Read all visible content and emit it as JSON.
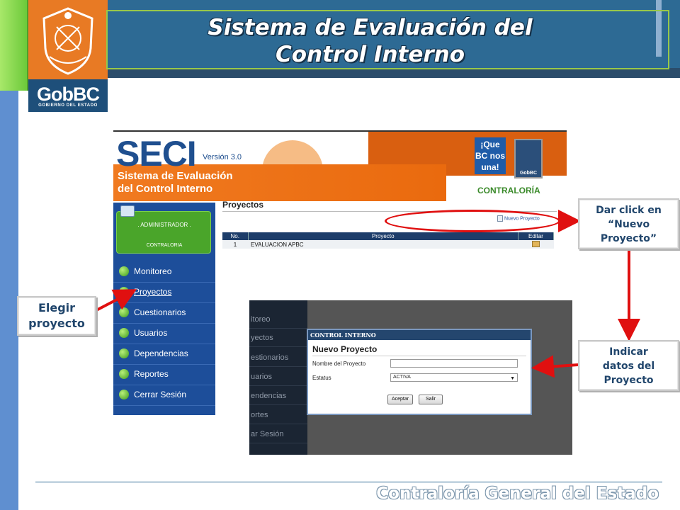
{
  "slide": {
    "title_line1": "Sistema de Evaluación del",
    "title_line2": "Control Interno",
    "footer": "Contraloría General del Estado",
    "logo_text": "GobBC",
    "logo_subtext": "GOBIERNO DEL ESTADO"
  },
  "app": {
    "brand_name": "SECI",
    "brand_version": "Versión 3.0",
    "brand_line1": "Sistema de Evaluación",
    "brand_line2": "del Control Interno",
    "badge_text": "¡Que BC nos una!",
    "badge2_text": "GobBC",
    "contraloria": "CONTRALORÍA",
    "user": {
      "role": ". ADMINISTRADOR .",
      "department": "CONTRALORIA"
    },
    "nav": [
      {
        "label": "Monitoreo"
      },
      {
        "label": "Proyectos"
      },
      {
        "label": "Cuestionarios"
      },
      {
        "label": "Usuarios"
      },
      {
        "label": "Dependencias"
      },
      {
        "label": "Reportes"
      },
      {
        "label": "Cerrar Sesión"
      }
    ],
    "projects": {
      "title": "Proyectos",
      "new_button": "Nuevo Proyecto",
      "columns": [
        "No.",
        "Proyecto",
        "Editar"
      ],
      "rows": [
        {
          "no": "1",
          "proyecto": "EVALUACION APBC"
        }
      ]
    }
  },
  "dialog": {
    "bg_nav": [
      "itoreo",
      "yectos",
      "estionarios",
      "uarios",
      "endencias",
      "ortes",
      "ar Sesión"
    ],
    "header": "CONTROL INTERNO",
    "title": "Nuevo Proyecto",
    "field_name_label": "Nombre del Proyecto",
    "field_name_value": "",
    "field_status_label": "Estatus",
    "field_status_value": "ACTIVA",
    "accept_label": "Aceptar",
    "exit_label": "Salir"
  },
  "callouts": {
    "click_new": "Dar click en “Nuevo Proyecto”",
    "choose_project": "Elegir proyecto",
    "enter_data": "Indicar datos del Proyecto"
  },
  "colors": {
    "arrow": "#e01010",
    "callout_text": "#21466c",
    "brand_blue": "#1d4e9a",
    "brand_orange": "#f07a20"
  }
}
